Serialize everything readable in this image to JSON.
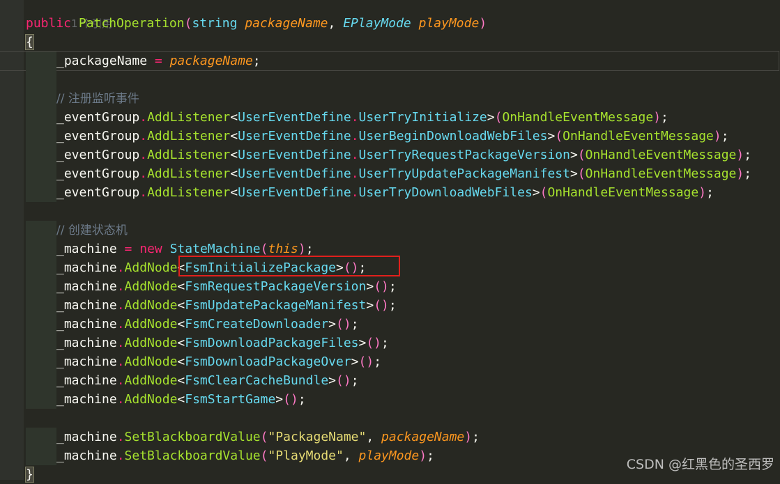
{
  "codelens": "1 个引用",
  "lines": {
    "sig": {
      "kw": "public",
      "name": "PatchOperation",
      "p_open": "(",
      "t1": "string",
      "a1": "packageName",
      "comma": ",",
      "t2": "EPlayMode",
      "a2": "playMode",
      "p_close": ")"
    },
    "open_brace": "{",
    "close_brace": "}",
    "assign": {
      "lhs": "_packageName",
      "eq": "=",
      "rhs": "packageName",
      "semi": ";"
    },
    "comment1": "// 注册监听事件",
    "comment2": "// 创建状态机",
    "event_group": "_eventGroup",
    "add_listener": "AddListener",
    "event_define": "UserEventDefine",
    "handler": "OnHandleEventMessage",
    "events": [
      "UserTryInitialize",
      "UserBeginDownloadWebFiles",
      "UserTryRequestPackageVersion",
      "UserTryUpdatePackageManifest",
      "UserTryDownloadWebFiles"
    ],
    "machine": "_machine",
    "new_kw": "new",
    "state_machine": "StateMachine",
    "this_kw": "this",
    "add_node": "AddNode",
    "nodes": [
      "FsmInitializePackage",
      "FsmRequestPackageVersion",
      "FsmUpdatePackageManifest",
      "FsmCreateDownloader",
      "FsmDownloadPackageFiles",
      "FsmDownloadPackageOver",
      "FsmClearCacheBundle",
      "FsmStartGame"
    ],
    "set_bb": "SetBlackboardValue",
    "bb1_key": "\"PackageName\"",
    "bb1_val": "packageName",
    "bb2_key": "\"PlayMode\"",
    "bb2_val": "playMode"
  },
  "watermark": "CSDN @红黑色的圣西罗"
}
